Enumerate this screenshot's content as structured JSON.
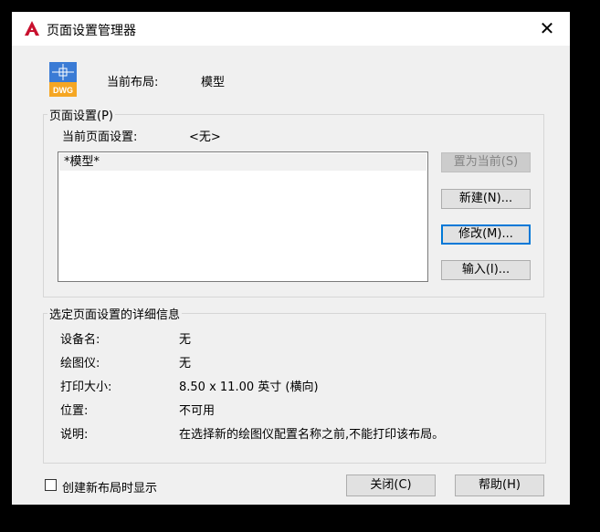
{
  "window": {
    "title": "页面设置管理器",
    "close_glyph": "✕"
  },
  "current_layout": {
    "label": "当前布局:",
    "value": "模型"
  },
  "page_setups": {
    "group_label": "页面设置(P)",
    "current_label": "当前页面设置:",
    "current_value": "<无>",
    "items": [
      "*模型*"
    ]
  },
  "buttons": {
    "set_current": "置为当前(S)",
    "new": "新建(N)...",
    "modify": "修改(M)...",
    "import": "输入(I)...",
    "close": "关闭(C)",
    "help": "帮助(H)"
  },
  "details": {
    "group_label": "选定页面设置的详细信息",
    "rows": [
      {
        "label": "设备名:",
        "value": "无"
      },
      {
        "label": "绘图仪:",
        "value": "无"
      },
      {
        "label": "打印大小:",
        "value": "8.50 x 11.00 英寸 (横向)"
      },
      {
        "label": "位置:",
        "value": "不可用"
      },
      {
        "label": "说明:",
        "value": "在选择新的绘图仪配置名称之前,不能打印该布局。"
      }
    ]
  },
  "checkbox": {
    "label": "创建新布局时显示",
    "checked": false
  },
  "icons": {
    "app": "autocad-logo-icon",
    "dwg": "dwg-file-icon",
    "dwg_text": "DWG"
  },
  "colors": {
    "accent": "#0078d7",
    "logo_red": "#c8102e",
    "dwg_orange": "#f5a623",
    "dwg_blue": "#3a7bd5"
  }
}
